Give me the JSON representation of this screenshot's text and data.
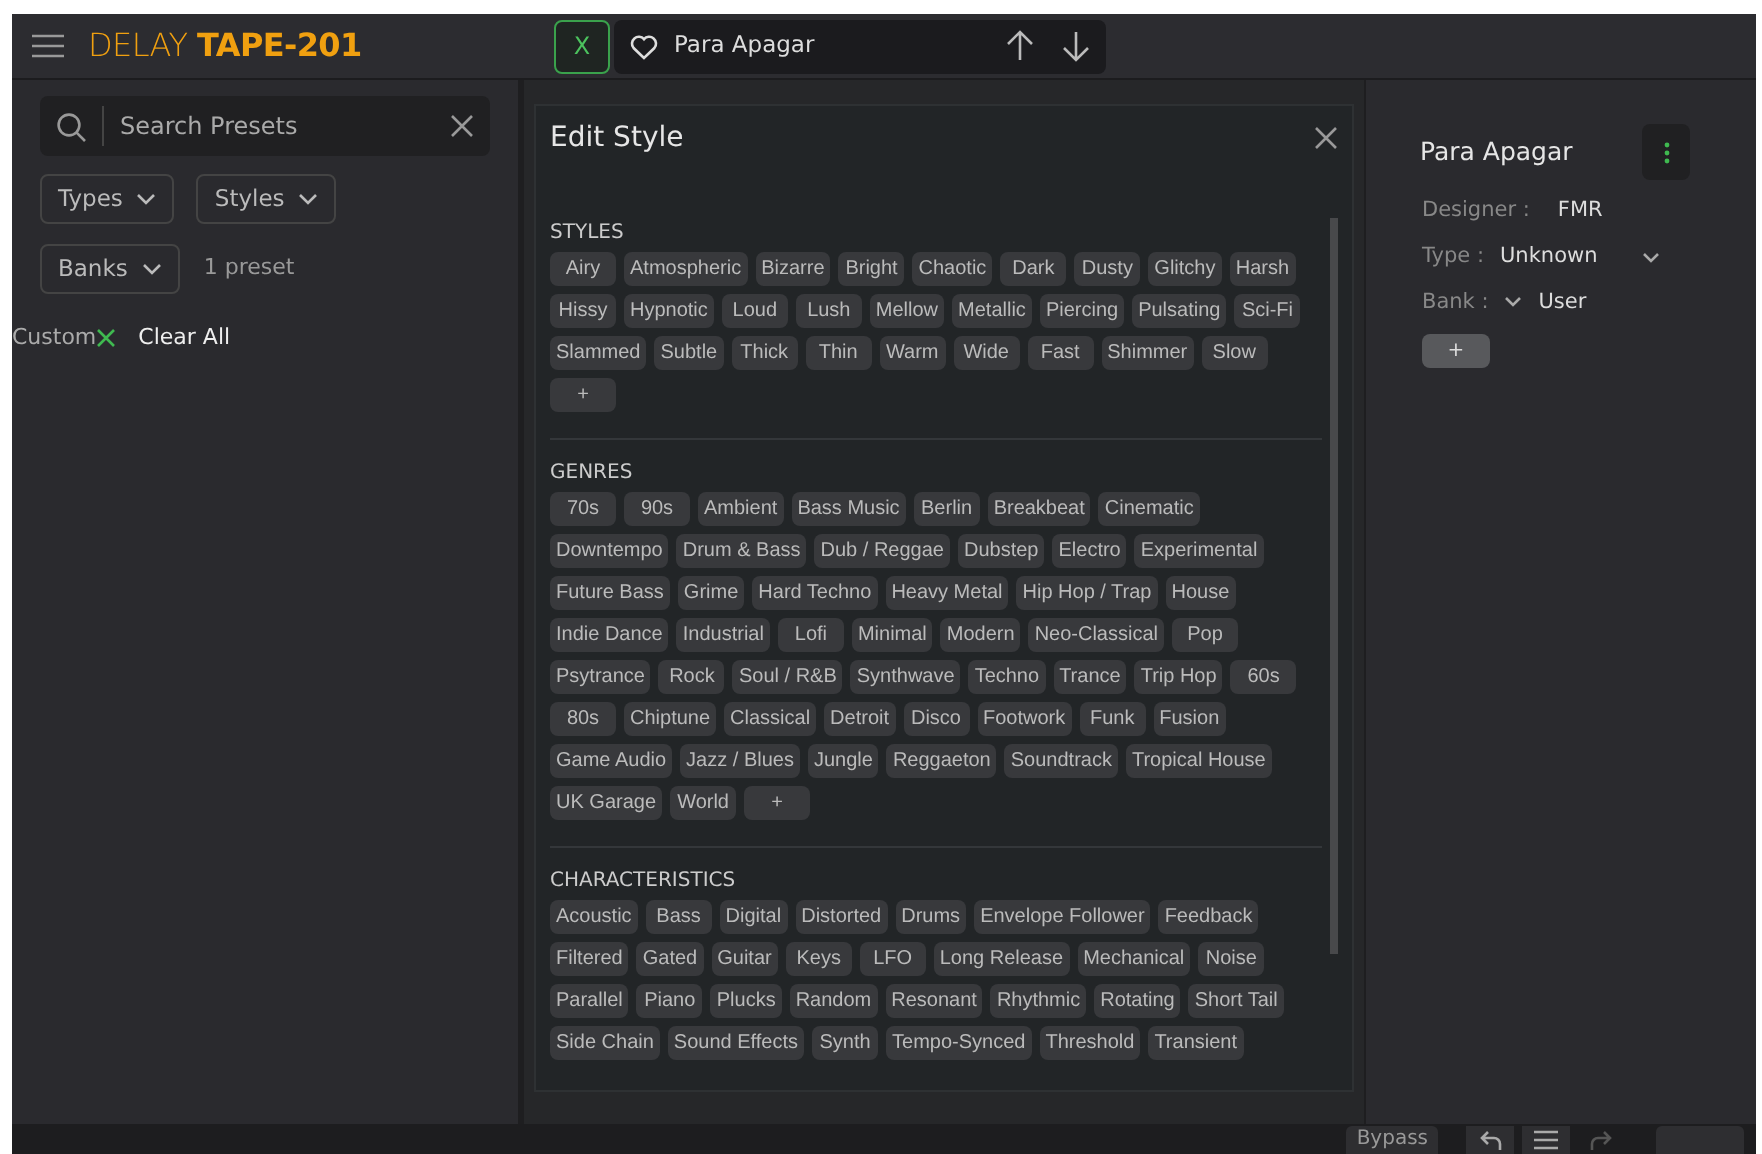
{
  "header": {
    "logo": "DELAY **TAPE-201**",
    "close_button": "X",
    "preset_name": "Para Apagar"
  },
  "browser": {
    "search": {
      "placeholder": "Search Presets"
    },
    "filters": [
      {
        "label": "Types"
      },
      {
        "label": "Styles"
      },
      {
        "label": "Banks"
      }
    ],
    "result_count": "1 preset",
    "active_filters": [
      {
        "label": "Custom"
      }
    ],
    "clear_all": "Clear All"
  },
  "dialog": {
    "title": "Edit Style",
    "sections": [
      {
        "heading": "STYLES",
        "add_label": "+",
        "tags": [
          "Airy",
          "Atmospheric",
          "Bizarre",
          "Bright",
          "Chaotic",
          "Dark",
          "Dusty",
          "Glitchy",
          "Harsh",
          "Hissy",
          "Hypnotic",
          "Loud",
          "Lush",
          "Mellow",
          "Metallic",
          "Piercing",
          "Pulsating",
          "Sci-Fi",
          "Slammed",
          "Subtle",
          "Thick",
          "Thin",
          "Warm",
          "Wide",
          "Fast",
          "Shimmer",
          "Slow"
        ]
      },
      {
        "heading": "GENRES",
        "add_label": "+",
        "tags": [
          "70s",
          "90s",
          "Ambient",
          "Bass Music",
          "Berlin",
          "Breakbeat",
          "Cinematic",
          "Downtempo",
          "Drum & Bass",
          "Dub / Reggae",
          "Dubstep",
          "Electro",
          "Experimental",
          "Future Bass",
          "Grime",
          "Hard Techno",
          "Heavy Metal",
          "Hip Hop / Trap",
          "House",
          "Indie Dance",
          "Industrial",
          "Lofi",
          "Minimal",
          "Modern",
          "Neo-Classical",
          "Pop",
          "Psytrance",
          "Rock",
          "Soul / R&B",
          "Synthwave",
          "Techno",
          "Trance",
          "Trip Hop",
          "60s",
          "80s",
          "Chiptune",
          "Classical",
          "Detroit",
          "Disco",
          "Footwork",
          "Funk",
          "Fusion",
          "Game Audio",
          "Jazz / Blues",
          "Jungle",
          "Reggaeton",
          "Soundtrack",
          "Tropical House",
          "UK Garage",
          "World"
        ]
      },
      {
        "heading": "CHARACTERISTICS",
        "tags": [
          "Acoustic",
          "Bass",
          "Digital",
          "Distorted",
          "Drums",
          "Envelope Follower",
          "Feedback",
          "Filtered",
          "Gated",
          "Guitar",
          "Keys",
          "LFO",
          "Long Release",
          "Mechanical",
          "Noise",
          "Parallel",
          "Piano",
          "Plucks",
          "Random",
          "Resonant",
          "Rhythmic",
          "Rotating",
          "Short Tail",
          "Side Chain",
          "Sound Effects",
          "Synth",
          "Tempo-Synced",
          "Threshold",
          "Transient"
        ]
      }
    ]
  },
  "info": {
    "name": "Para Apagar",
    "fields": [
      {
        "label": "Designer :",
        "value": "FMR",
        "kind": "text"
      },
      {
        "label": "Type :",
        "value": "Unknown",
        "kind": "dropdown-after"
      },
      {
        "label": "Bank :",
        "value": "User",
        "kind": "dropdown-before"
      }
    ],
    "add_button": "+"
  },
  "footer": {
    "bypass": "Bypass"
  }
}
